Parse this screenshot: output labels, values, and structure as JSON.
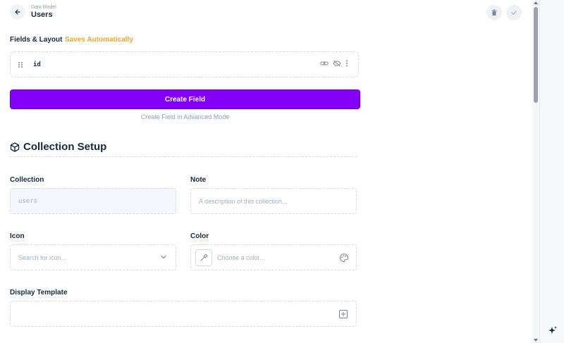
{
  "header": {
    "breadcrumb": "Data Model",
    "title": "Users"
  },
  "fields_section": {
    "label": "Fields & Layout",
    "autosave": "Saves Automatically",
    "fields": [
      {
        "name": "id"
      }
    ],
    "create_button": "Create Field",
    "advanced_link": "Create Field in Advanced Mode"
  },
  "collection_setup": {
    "title": "Collection Setup",
    "collection": {
      "label": "Collection",
      "value": "users"
    },
    "note": {
      "label": "Note",
      "placeholder": "A description of this collection..."
    },
    "icon": {
      "label": "Icon",
      "placeholder": "Search for icon..."
    },
    "color": {
      "label": "Color",
      "placeholder": "Choose a color..."
    },
    "display_template": {
      "label": "Display Template",
      "value": ""
    }
  },
  "colors": {
    "primary": "#8400f7",
    "warning": "#f5a42a",
    "text": "#172940",
    "muted": "#8ea0b7"
  }
}
